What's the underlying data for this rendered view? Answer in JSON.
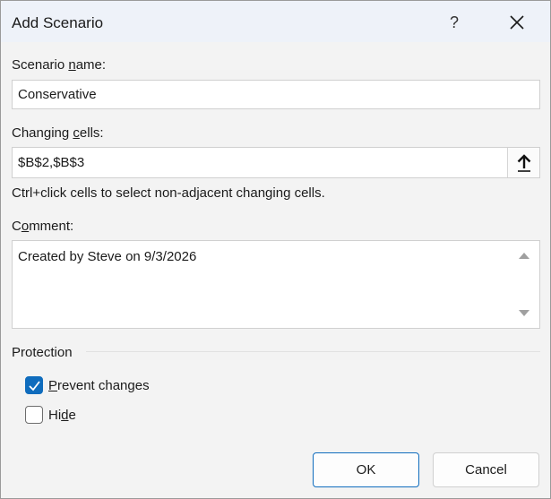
{
  "dialog": {
    "title": "Add Scenario",
    "help_label": "?",
    "close_icon": "close-icon"
  },
  "scenario_name": {
    "label_pre": "Scenario ",
    "label_key": "n",
    "label_post": "ame:",
    "value": "Conservative"
  },
  "changing_cells": {
    "label_pre": "Changing ",
    "label_key": "c",
    "label_post": "ells:",
    "value": "$B$2,$B$3",
    "collapse_icon": "arrow-up-icon",
    "hint": "Ctrl+click cells to select non-adjacent changing cells."
  },
  "comment": {
    "label_pre": "C",
    "label_key": "o",
    "label_post": "mment:",
    "value": "Created by Steve on 9/3/2026"
  },
  "protection": {
    "heading": "Protection",
    "prevent_changes": {
      "label_key": "P",
      "label_post": "revent changes",
      "checked": true
    },
    "hide": {
      "label_pre": "Hi",
      "label_key": "d",
      "label_post": "e",
      "checked": false
    }
  },
  "buttons": {
    "ok": "OK",
    "cancel": "Cancel"
  },
  "colors": {
    "accent": "#0f6cbd",
    "titlebar": "#eef2f9",
    "dialog_bg": "#f3f3f3"
  }
}
